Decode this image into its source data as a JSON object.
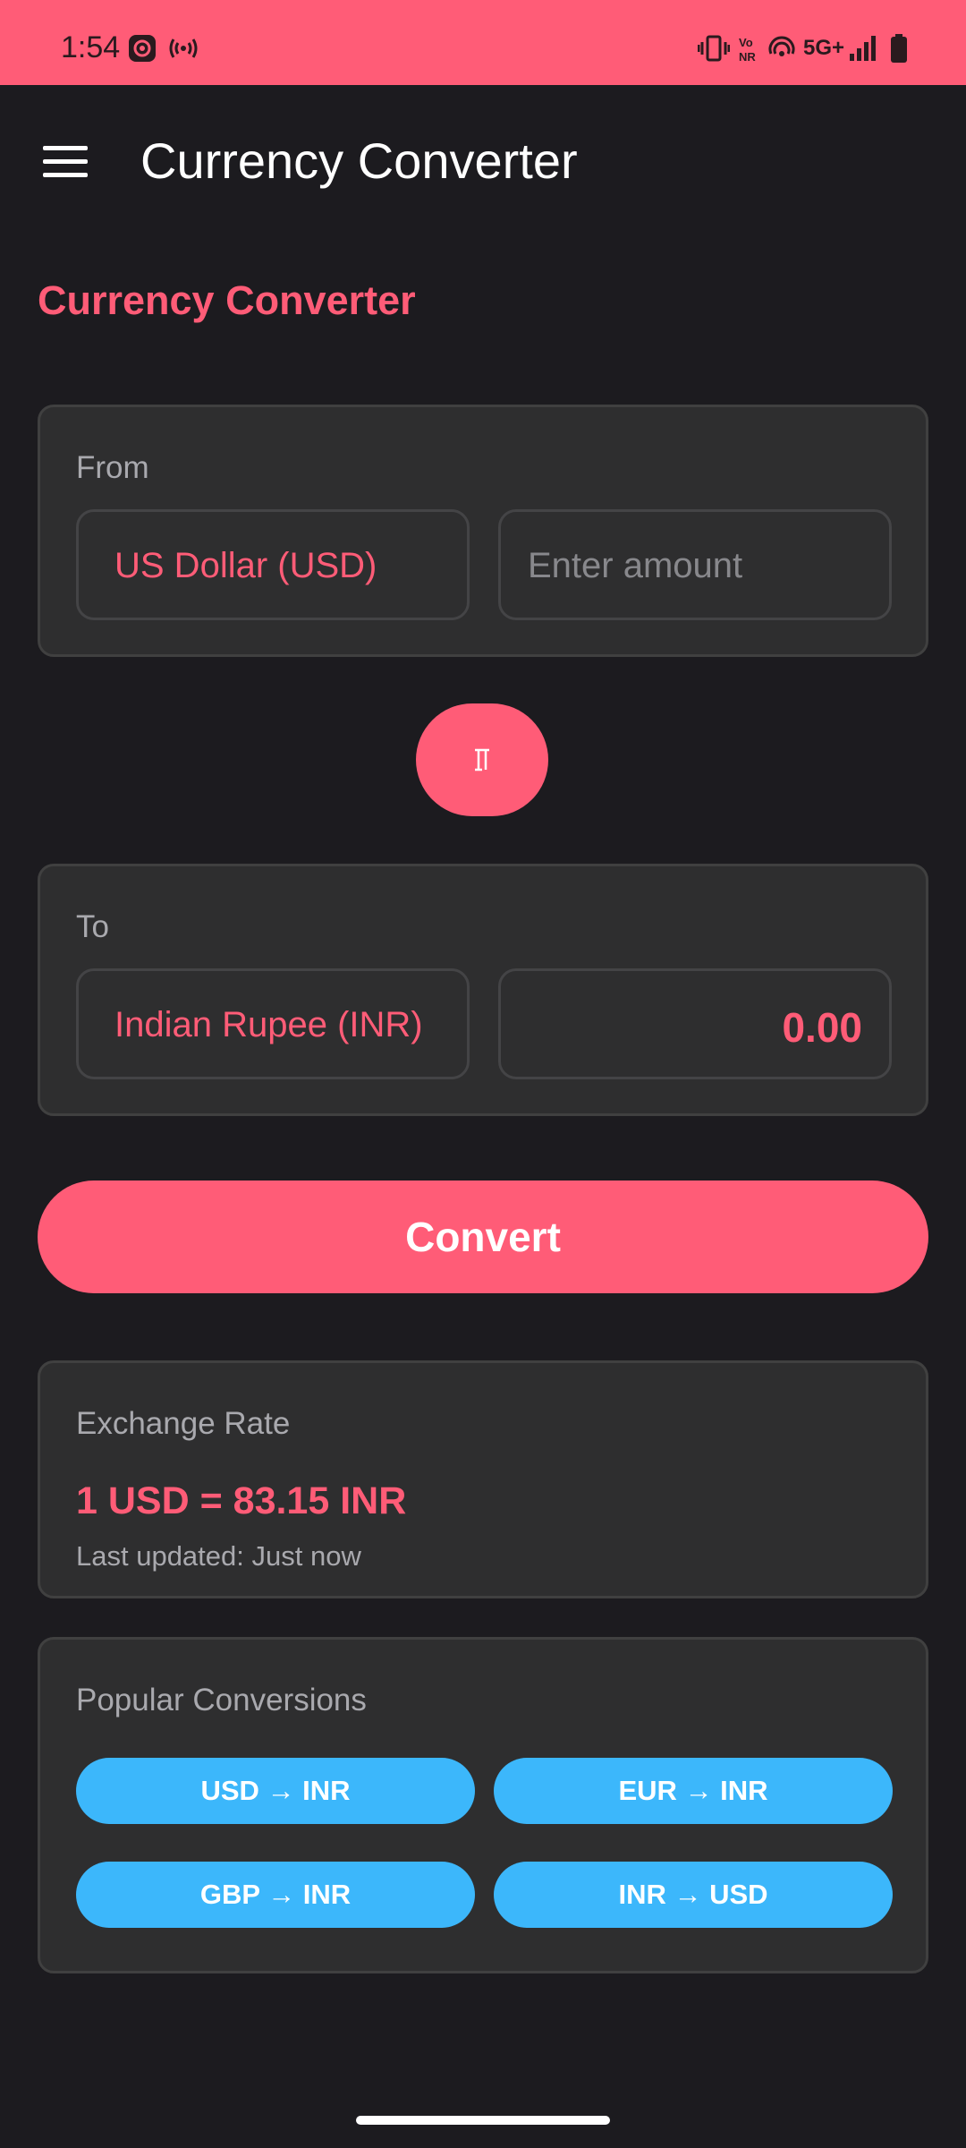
{
  "status_bar": {
    "time": "1:54",
    "network": "5G+",
    "icons": [
      "camera-icon",
      "hotspot-icon",
      "vibrate-icon",
      "volte-icon",
      "wifi-calling-icon",
      "signal-icon",
      "battery-icon"
    ]
  },
  "app_bar": {
    "title": "Currency Converter",
    "menu_icon": "hamburger-menu-icon"
  },
  "main": {
    "heading": "Currency Converter",
    "from": {
      "label": "From",
      "currency": "US Dollar (USD)",
      "amount_placeholder": "Enter amount",
      "amount_value": ""
    },
    "swap_icon": "swap-vertical-icon",
    "to": {
      "label": "To",
      "currency": "Indian Rupee (INR)",
      "result": "0.00"
    },
    "convert_label": "Convert",
    "exchange_rate": {
      "label": "Exchange Rate",
      "value": "1 USD = 83.15 INR",
      "updated": "Last updated: Just now"
    },
    "popular": {
      "label": "Popular Conversions",
      "items": [
        "USD → INR",
        "EUR → INR",
        "GBP → INR",
        "INR → USD"
      ]
    }
  },
  "colors": {
    "accent": "#ff5c77",
    "pill": "#3cb7fb",
    "background": "#1c1b1f",
    "card": "#2e2e2f"
  }
}
